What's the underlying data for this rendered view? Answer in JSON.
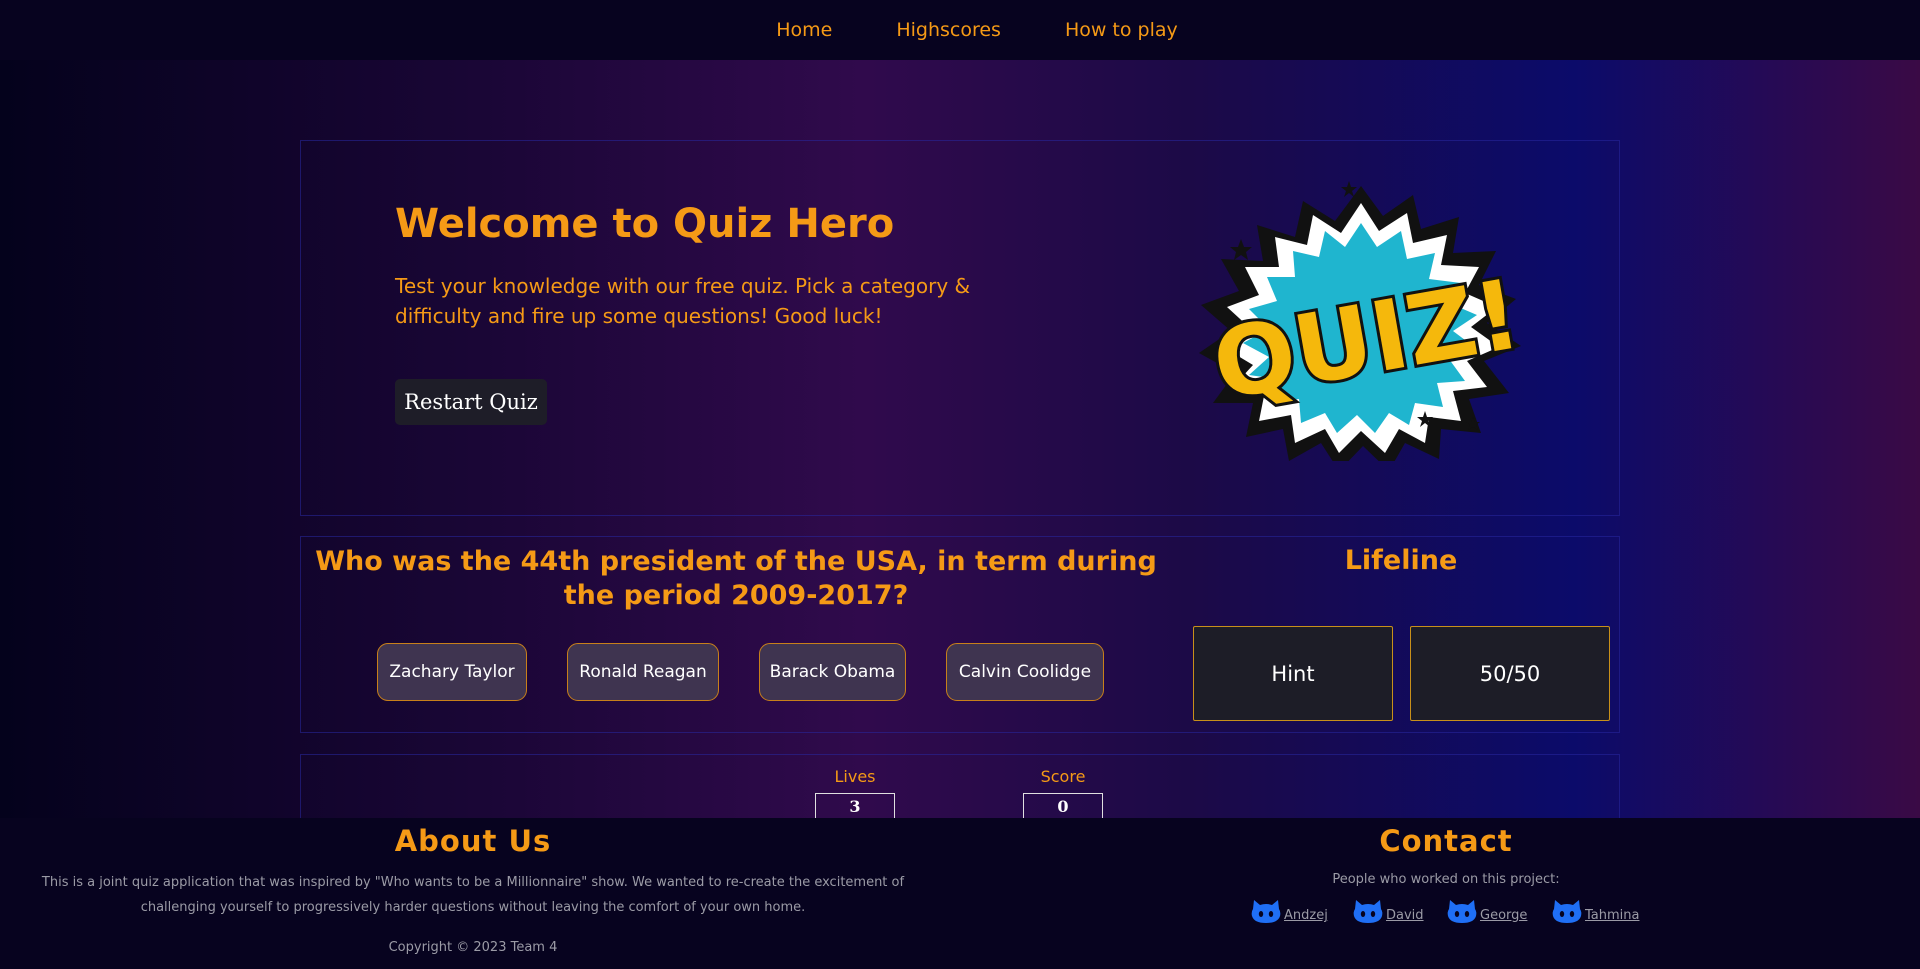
{
  "nav": {
    "items": [
      {
        "label": "Home"
      },
      {
        "label": "Highscores"
      },
      {
        "label": "How to play"
      }
    ]
  },
  "hero": {
    "title": "Welcome to Quiz Hero",
    "subtitle": "Test your knowledge with our free quiz. Pick a category & difficulty and fire up some questions! Good luck!",
    "restart_label": "Restart Quiz",
    "logo_text": "QUIZ!"
  },
  "quiz": {
    "question": "Who was the 44th president of the USA, in term during the period 2009-2017?",
    "answers": [
      {
        "label": "Zachary Taylor"
      },
      {
        "label": "Ronald Reagan"
      },
      {
        "label": "Barack Obama"
      },
      {
        "label": "Calvin Coolidge"
      }
    ]
  },
  "lifeline": {
    "title": "Lifeline",
    "hint_label": "Hint",
    "fifty_label": "50/50"
  },
  "stats": {
    "lives_label": "Lives",
    "lives_value": "3",
    "score_label": "Score",
    "score_value": "0"
  },
  "footer": {
    "about_title": "About Us",
    "about_text": "This is a joint quiz application that was inspired by \"Who wants to be a Millionnaire\" show. We wanted to re-create the excitement of challenging yourself to progressively harder questions without leaving the comfort of your own home.",
    "copyright": "Copyright © 2023 Team 4",
    "contact_title": "Contact",
    "contact_text": "People who worked on this project:",
    "people": [
      {
        "name": " Andzej",
        "icon": "github-icon"
      },
      {
        "name": " David",
        "icon": "github-icon"
      },
      {
        "name": " George",
        "icon": "github-icon"
      },
      {
        "name": " Tahmina",
        "icon": "github-icon"
      }
    ]
  },
  "colors": {
    "accent": "#f59a16",
    "background": "#07031f",
    "button_dark": "#1e1d28",
    "answer_bg": "#3f3450",
    "github_blue": "#1f6ff5"
  }
}
